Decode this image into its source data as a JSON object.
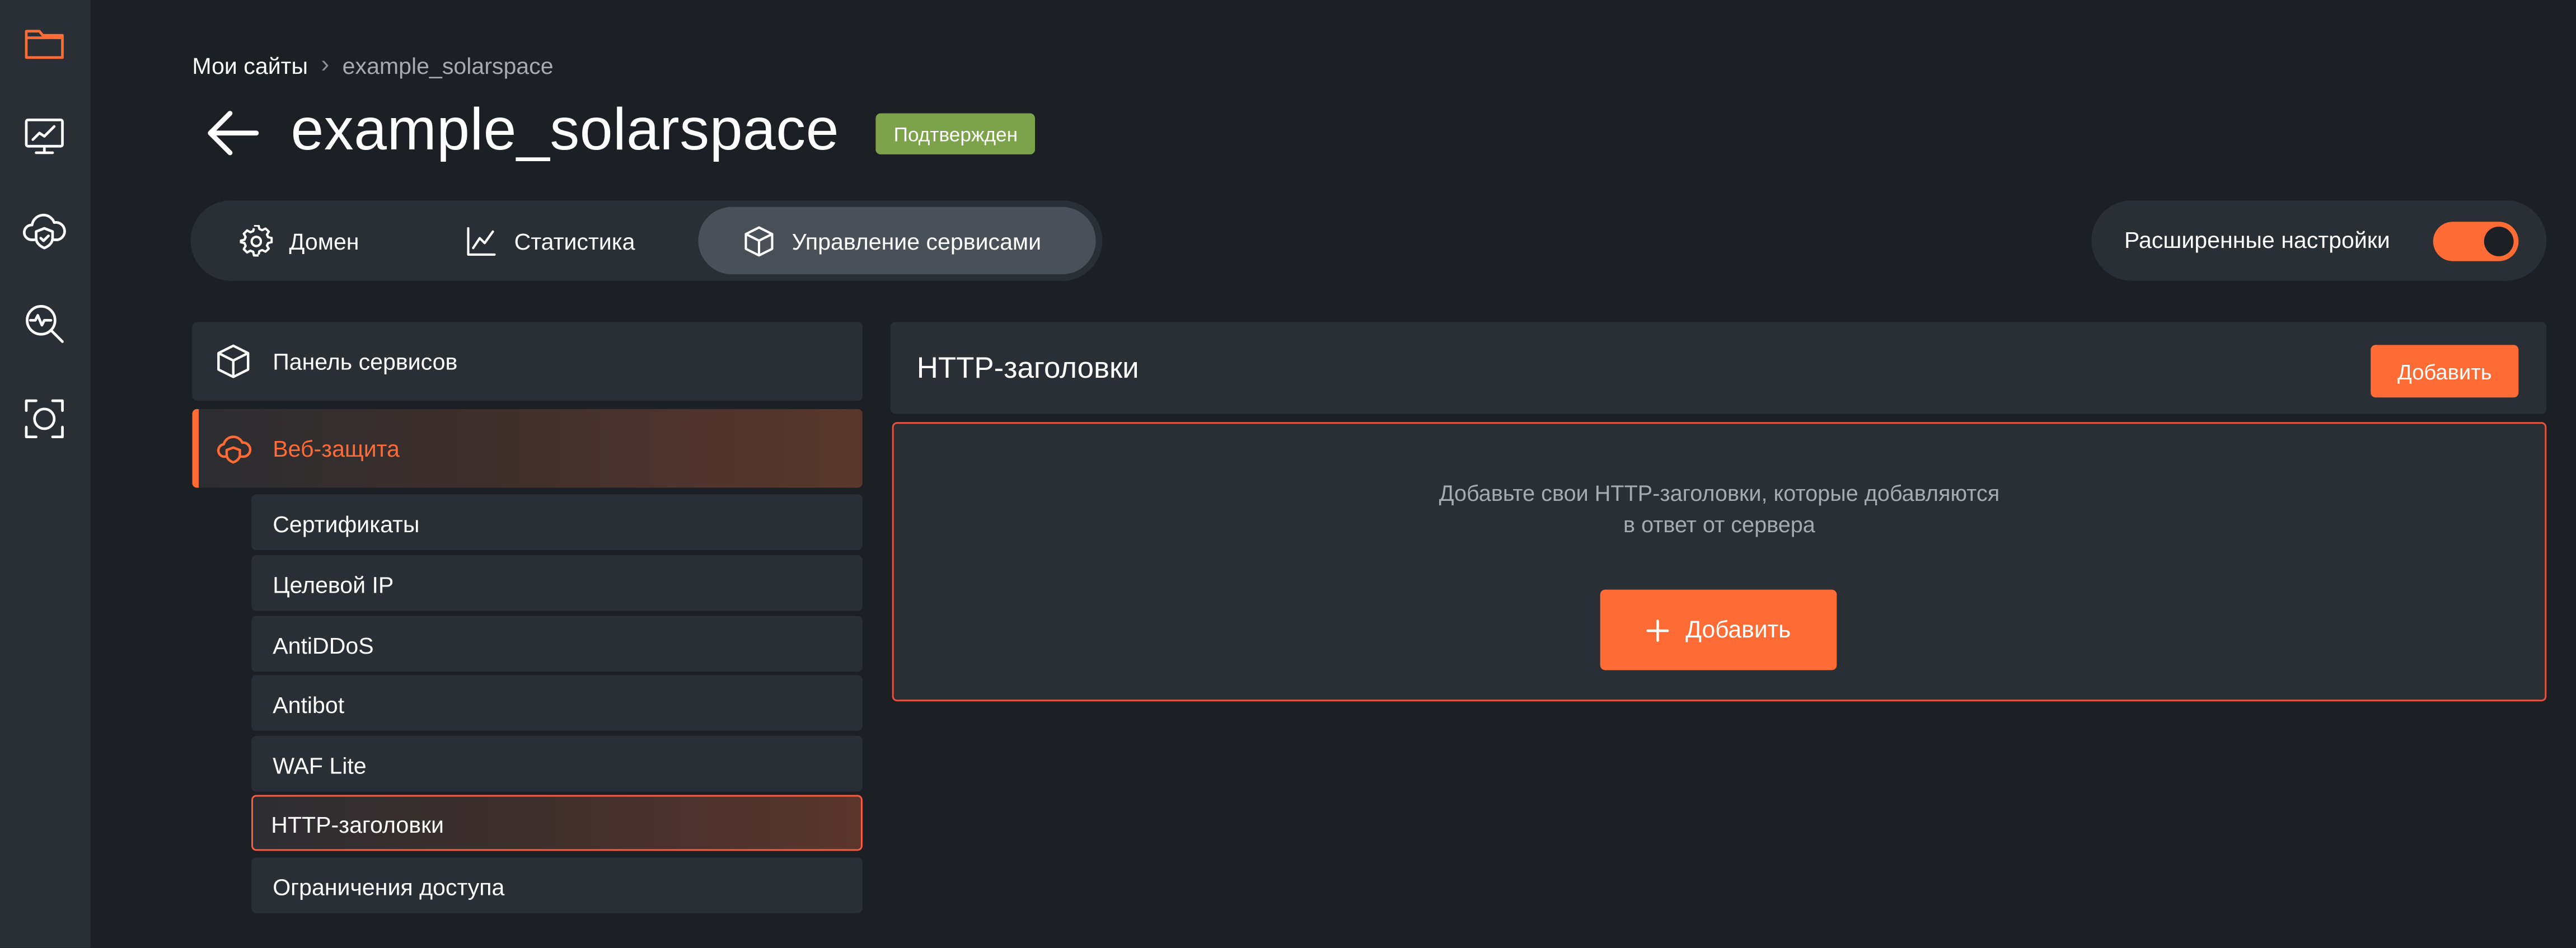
{
  "breadcrumb": {
    "root": "Мои сайты",
    "separator": ">",
    "current": "example_solarspace"
  },
  "page": {
    "title": "example_solarspace",
    "status_badge": "Подтвержден"
  },
  "tabs": [
    {
      "label": "Домен",
      "icon": "gear-icon"
    },
    {
      "label": "Статистика",
      "icon": "line-chart-icon"
    },
    {
      "label": "Управление сервисами",
      "icon": "cube-icon",
      "active": true
    }
  ],
  "advanced_settings": {
    "label": "Расширенные настройки",
    "enabled": true
  },
  "sidebar": {
    "main_items": [
      {
        "label": "Панель сервисов",
        "icon": "cube-icon"
      },
      {
        "label": "Веб-защита",
        "icon": "cloud-shield-icon",
        "active": true
      }
    ],
    "sub_items": [
      {
        "label": "Сертификаты"
      },
      {
        "label": "Целевой IP"
      },
      {
        "label": "AntiDDoS"
      },
      {
        "label": "Antibot"
      },
      {
        "label": "WAF Lite"
      },
      {
        "label": "HTTP-заголовки",
        "active": true
      },
      {
        "label": "Ограничения доступа"
      }
    ]
  },
  "panel": {
    "title": "HTTP-заголовки",
    "add_button": "Добавить",
    "empty_line1": "Добавьте свои HTTP-заголовки, которые добавляются",
    "empty_line2": "в ответ от сервера",
    "add_big_button": "Добавить",
    "add_big_icon": "plus-icon"
  },
  "rail_icons": [
    "folder-icon",
    "monitor-chart-icon",
    "cloud-shield-icon",
    "search-pulse-icon",
    "scan-icon"
  ],
  "colors": {
    "background": "#1c1f24",
    "surface": "#2a2e35",
    "accent": "#ff6b35",
    "badge_green": "#7ca34a",
    "muted_text": "#a6aab1"
  }
}
